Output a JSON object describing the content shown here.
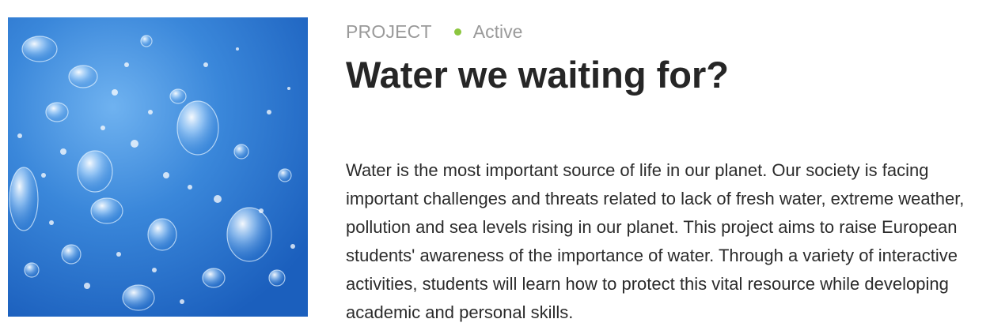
{
  "card": {
    "image_alt": "Water bubbles",
    "type_label": "PROJECT",
    "status_label": "Active",
    "status_color": "#8cc63f",
    "title": "Water we waiting for?",
    "description": "Water is the most important source of life in our planet. Our society is facing important challenges and threats related to lack of fresh water, extreme weather, pollution and sea levels rising in our planet. This project aims to raise European students' awareness of the importance of water. Through a variety of interactive activities, students will learn how to protect this vital resource while developing academic and personal skills."
  }
}
